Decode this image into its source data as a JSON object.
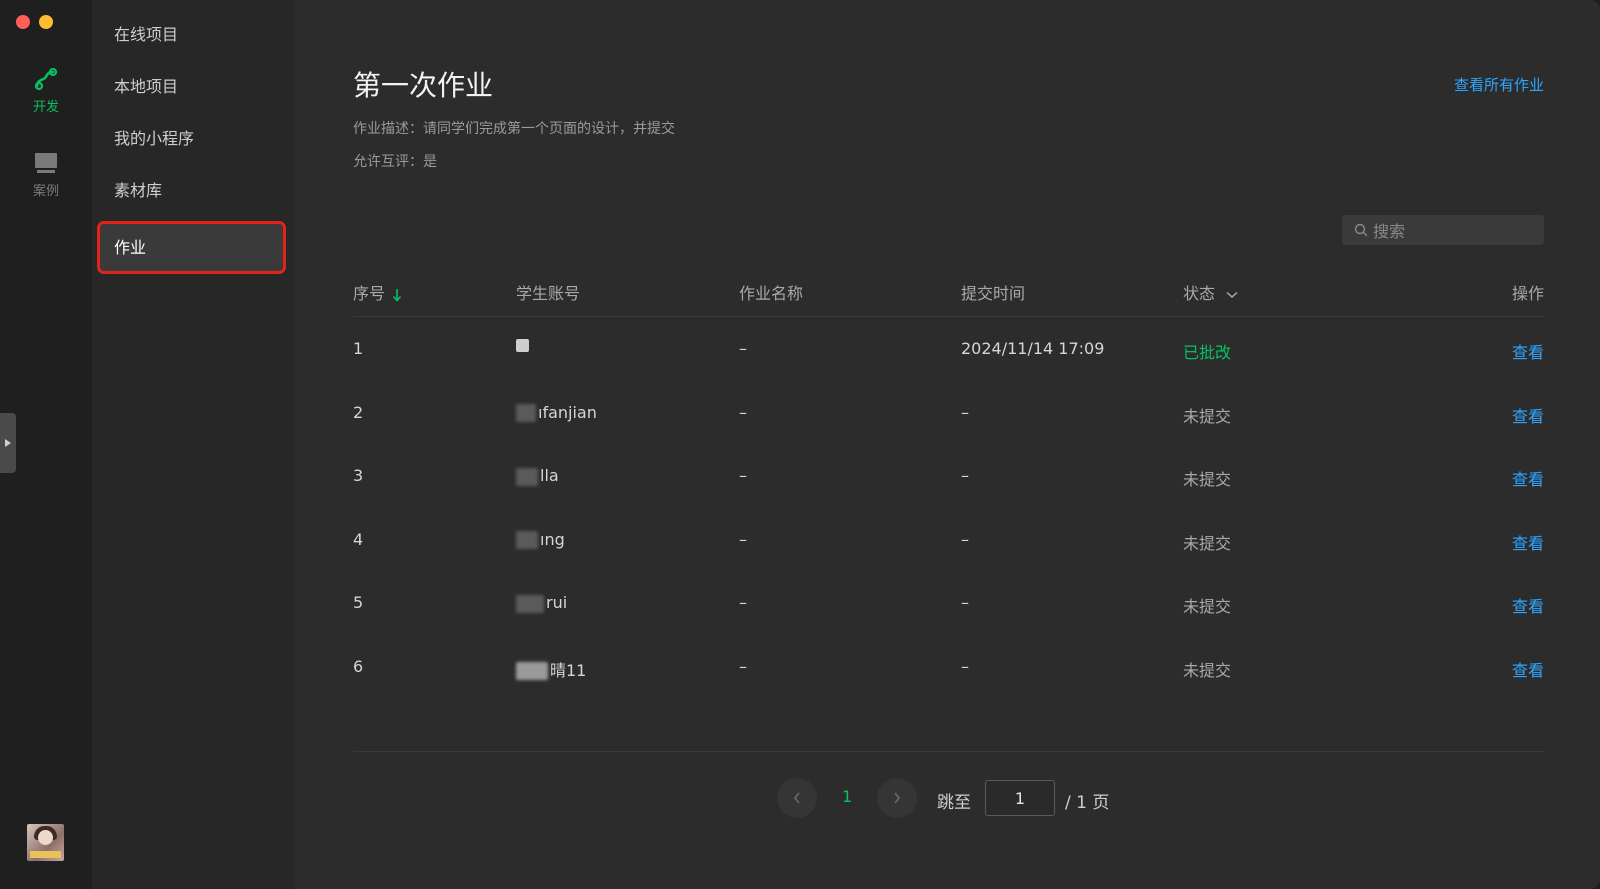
{
  "rail": {
    "items": [
      {
        "label": "开发",
        "icon": "link-icon",
        "active": true
      },
      {
        "label": "案例",
        "icon": "monitor-icon",
        "active": false
      }
    ]
  },
  "nav": {
    "items": [
      {
        "label": "在线项目"
      },
      {
        "label": "本地项目"
      },
      {
        "label": "我的小程序"
      },
      {
        "label": "素材库"
      },
      {
        "label": "作业",
        "active": true
      }
    ]
  },
  "main": {
    "title": "第一次作业",
    "view_all": "查看所有作业",
    "description": "作业描述：请同学们完成第一个页面的设计，并提交",
    "peer_review": "允许互评：是",
    "search_placeholder": "搜索"
  },
  "table": {
    "headers": {
      "idx": "序号",
      "account": "学生账号",
      "name": "作业名称",
      "time": "提交时间",
      "status": "状态",
      "op": "操作"
    },
    "rows": [
      {
        "idx": "1",
        "account": "",
        "name": "–",
        "time": "2024/11/14 17:09",
        "status": "已批改",
        "op": "查看"
      },
      {
        "idx": "2",
        "account": "ıfanjian",
        "name": "–",
        "time": "–",
        "status": "未提交",
        "op": "查看"
      },
      {
        "idx": "3",
        "account": "lla",
        "name": "–",
        "time": "–",
        "status": "未提交",
        "op": "查看"
      },
      {
        "idx": "4",
        "account": "ıng",
        "name": "–",
        "time": "–",
        "status": "未提交",
        "op": "查看"
      },
      {
        "idx": "5",
        "account": "rui",
        "name": "–",
        "time": "–",
        "status": "未提交",
        "op": "查看"
      },
      {
        "idx": "6",
        "account": "晴11",
        "name": "–",
        "time": "–",
        "status": "未提交",
        "op": "查看"
      }
    ]
  },
  "pager": {
    "current": "1",
    "jump_label": "跳至",
    "input_value": "1",
    "total": "/ 1 页"
  },
  "colors": {
    "accent_green": "#07c160",
    "link_blue": "#2ea6ff",
    "highlight_red": "#e0241c"
  }
}
